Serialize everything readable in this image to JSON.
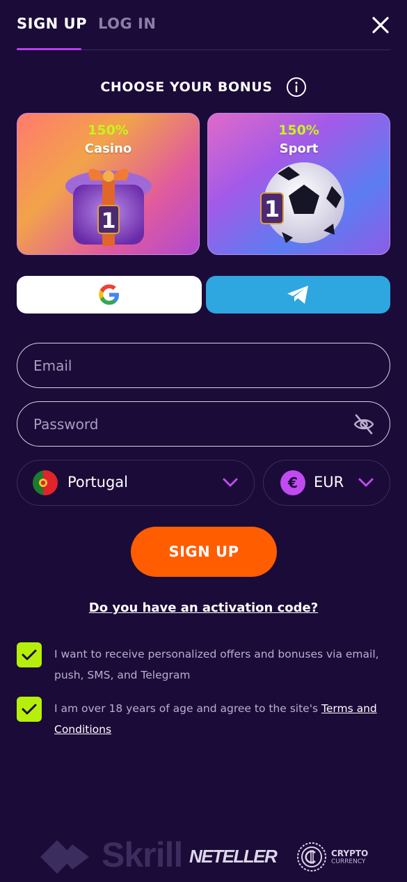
{
  "tabs": {
    "signup": "SIGN UP",
    "login": "LOG IN"
  },
  "bonus": {
    "title": "CHOOSE YOUR BONUS",
    "cards": [
      {
        "percent": "150%",
        "name": "Casino"
      },
      {
        "percent": "150%",
        "name": "Sport"
      }
    ]
  },
  "form": {
    "email_placeholder": "Email",
    "password_placeholder": "Password",
    "country": "Portugal",
    "currency": "EUR",
    "currency_symbol": "€",
    "submit_label": "SIGN UP",
    "activation_link": "Do you have an activation code?"
  },
  "consents": {
    "offers": "I want to receive personalized offers and bonuses via email, push, SMS, and Telegram",
    "age_prefix": "I am over 18 years of age and agree to the site's",
    "age_link": "Terms and Conditions"
  },
  "footer": {
    "skrill": "Skrill",
    "neteller": "NETELLER",
    "crypto_line1": "CRYPTO",
    "crypto_line2": "CURRENCY"
  },
  "colors": {
    "background": "#1b0b38",
    "accent_purple": "#b83ef0",
    "bonus_green": "#c6f51a",
    "submit_orange": "#ff5d00",
    "telegram_blue": "#2ea6e0",
    "checkbox_green": "#b6f00a"
  }
}
